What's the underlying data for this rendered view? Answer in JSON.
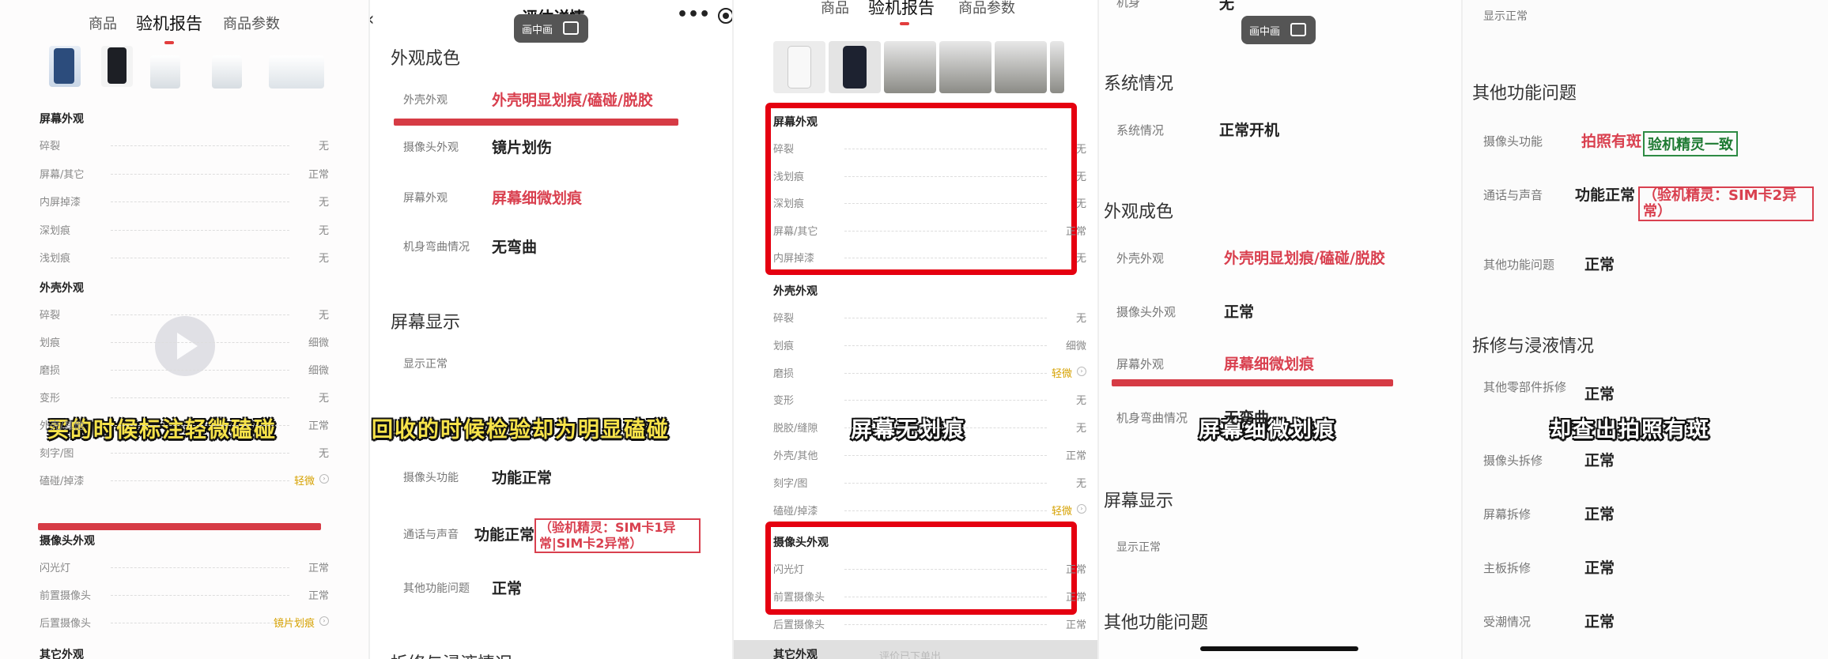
{
  "p1": {
    "tabs": [
      "商品",
      "验机报告",
      "商品参数"
    ],
    "screen_title": "屏幕外观",
    "screen_rows": [
      {
        "label": "碎裂",
        "value": "无"
      },
      {
        "label": "屏幕/其它",
        "value": "正常"
      },
      {
        "label": "内屏掉漆",
        "value": "无"
      },
      {
        "label": "深划痕",
        "value": "无"
      },
      {
        "label": "浅划痕",
        "value": "无"
      }
    ],
    "shell_title": "外壳外观",
    "shell_rows": [
      {
        "label": "碎裂",
        "value": "无"
      },
      {
        "label": "划痕",
        "value": "细微"
      },
      {
        "label": "磨损",
        "value": "细微"
      },
      {
        "label": "变形",
        "value": "无"
      },
      {
        "label": "外壳/其他",
        "value": "正常"
      },
      {
        "label": "刻字/图",
        "value": "无"
      },
      {
        "label": "磕碰/掉漆",
        "value": "轻微"
      }
    ],
    "camera_title": "摄像头外观",
    "camera_rows": [
      {
        "label": "闪光灯",
        "value": "正常"
      },
      {
        "label": "前置摄像头",
        "value": "正常"
      },
      {
        "label": "后置摄像头",
        "value": "镜片划痕"
      }
    ],
    "other_title": "其它外观",
    "subtitle": "买的时候标注轻微磕碰"
  },
  "p2": {
    "top_title": "评估详情",
    "sec1": "外观成色",
    "rows1": [
      {
        "k": "外壳外观",
        "v": "外壳明显划痕/磕碰/脱胶",
        "red": true
      },
      {
        "k": "摄像头外观",
        "v": "镜片划伤",
        "red": false
      },
      {
        "k": "屏幕外观",
        "v": "屏幕细微划痕",
        "red": true
      },
      {
        "k": "机身弯曲情况",
        "v": "无弯曲",
        "red": false
      }
    ],
    "sec2": "屏幕显示",
    "display_row": "显示正常",
    "rows2": [
      {
        "k": "摄像头功能",
        "v": "功能正常"
      },
      {
        "k": "通话与声音",
        "v": "功能正常"
      },
      {
        "k": "其他功能问题",
        "v": "正常"
      }
    ],
    "tag": "（验机精灵：SIM卡1异常|SIM卡2异常）",
    "sec3": "拆修与浸液情况",
    "subtitle": "回收的时候检验却为明显磕碰"
  },
  "p3": {
    "tabs": [
      "商品",
      "验机报告",
      "商品参数"
    ],
    "screen_title": "屏幕外观",
    "screen_rows": [
      {
        "label": "碎裂",
        "value": "无"
      },
      {
        "label": "浅划痕",
        "value": "无"
      },
      {
        "label": "深划痕",
        "value": "无"
      },
      {
        "label": "屏幕/其它",
        "value": "正常"
      },
      {
        "label": "内屏掉漆",
        "value": "无"
      }
    ],
    "shell_title": "外壳外观",
    "shell_rows": [
      {
        "label": "碎裂",
        "value": "无"
      },
      {
        "label": "划痕",
        "value": "细微"
      },
      {
        "label": "磨损",
        "value": "轻微"
      },
      {
        "label": "变形",
        "value": "无"
      },
      {
        "label": "脱胶/缝隙",
        "value": "无"
      },
      {
        "label": "外壳/其他",
        "value": "正常"
      },
      {
        "label": "刻字/图",
        "value": "无"
      },
      {
        "label": "磕碰/掉漆",
        "value": "轻微"
      }
    ],
    "camera_title": "摄像头外观",
    "camera_rows": [
      {
        "label": "闪光灯",
        "value": "正常"
      },
      {
        "label": "前置摄像头",
        "value": "正常"
      },
      {
        "label": "后置摄像头",
        "value": "正常"
      }
    ],
    "other_title": "其它外观",
    "bottom_text": "评价已下单出",
    "subtitle": "屏幕无划痕"
  },
  "p4": {
    "top_k": "机身",
    "top_v": "无",
    "sec1": "系统情况",
    "sys_k": "系统情况",
    "sys_v": "正常开机",
    "sec2": "外观成色",
    "rows": [
      {
        "k": "外壳外观",
        "v": "外壳明显划痕/磕碰/脱胶",
        "red": true
      },
      {
        "k": "摄像头外观",
        "v": "正常",
        "red": false
      },
      {
        "k": "屏幕外观",
        "v": "屏幕细微划痕",
        "red": true
      },
      {
        "k": "机身弯曲情况",
        "v": "无弯曲",
        "red": false
      }
    ],
    "sec3": "屏幕显示",
    "display_row": "显示正常",
    "sec4": "其他功能问题",
    "subtitle": "屏幕细微划痕"
  },
  "p5": {
    "top_row": "显示正常",
    "sec1": "其他功能问题",
    "rows1": [
      {
        "k": "摄像头功能",
        "v": "拍照有斑",
        "red": true
      },
      {
        "k": "通话与声音",
        "v": "功能正常",
        "red": false
      },
      {
        "k": "其他功能问题",
        "v": "正常",
        "red": false
      }
    ],
    "green_tag": "验机精灵一致",
    "red_tag": "（验机精灵：SIM卡2异常）",
    "sec2": "拆修与浸液情况",
    "rows2": [
      {
        "k": "其他零部件拆修",
        "v": "正常"
      },
      {
        "k": "摄像头拆修",
        "v": "正常"
      },
      {
        "k": "屏幕拆修",
        "v": "正常"
      },
      {
        "k": "主板拆修",
        "v": "正常"
      },
      {
        "k": "受潮情况",
        "v": "正常"
      }
    ],
    "subtitle": "却查出拍照有斑"
  },
  "pip_label": "画中画",
  "colors": {
    "accent_red": "#e23d3d",
    "highlight_box": "#e50010",
    "tag_green": "#2e8b44"
  }
}
